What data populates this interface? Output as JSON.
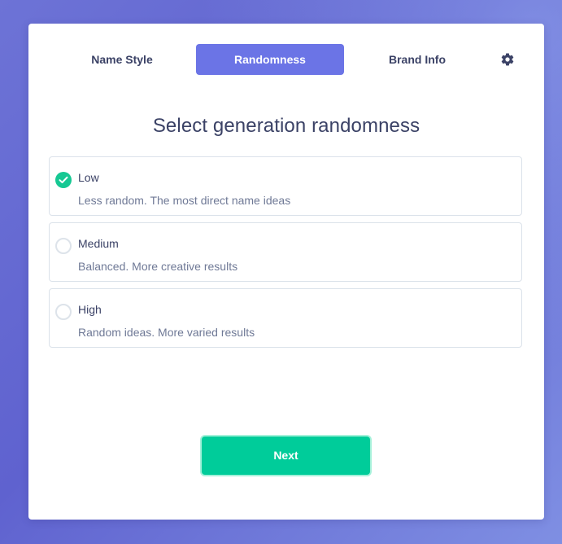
{
  "tabs": [
    {
      "label": "Name Style",
      "active": false
    },
    {
      "label": "Randomness",
      "active": true
    },
    {
      "label": "Brand Info",
      "active": false
    }
  ],
  "settings_icon": "gear-icon",
  "title": "Select generation randomness",
  "options": [
    {
      "label": "Low",
      "description": "Less random. The most direct name ideas",
      "selected": true
    },
    {
      "label": "Medium",
      "description": "Balanced. More creative results",
      "selected": false
    },
    {
      "label": "High",
      "description": "Random ideas. More varied results",
      "selected": false
    }
  ],
  "next_label": "Next",
  "colors": {
    "accent": "#6b74e6",
    "success": "#00cc9a",
    "text": "#3b4266",
    "muted_text": "#6f7996"
  }
}
